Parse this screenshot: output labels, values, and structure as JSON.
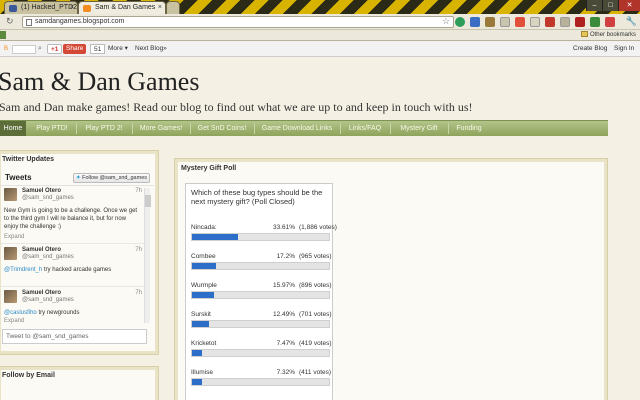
{
  "browser": {
    "tabs": [
      {
        "label": "(1) Hacked_PTD2"
      },
      {
        "label": "Sam & Dan Games"
      }
    ],
    "url": "samdangames.blogspot.com",
    "other_bookmarks": "Other bookmarks"
  },
  "navbar": {
    "share_label": "Share",
    "count": "51",
    "more": "More",
    "next_blog": "Next Blog»",
    "create_blog": "Create Blog",
    "sign_in": "Sign In"
  },
  "header": {
    "title": "Sam & Dan Games",
    "description": "Sam and Dan make games! Read our blog to find out what we are up to and keep in touch with us!"
  },
  "nav_tabs": [
    "Home",
    "Play PTD!",
    "Play PTD 2!",
    "More Games!",
    "Get SnD Coins!",
    "Game Download Links",
    "Links/FAQ",
    "Mystery Gift",
    "Funding"
  ],
  "twitter": {
    "title": "Twitter Updates",
    "header_label": "Tweets",
    "follow_label": "Follow @sam_snd_games",
    "tweets": [
      {
        "name": "Samuel Otero",
        "handle": "@sam_snd_games",
        "time": "7h",
        "text": "New Gym is going to be a challenge. Once we get to the third gym I will re balance it, but for now enjoy the challenge :)",
        "expand": "Expand"
      },
      {
        "name": "Samuel Otero",
        "handle": "@sam_snd_games",
        "time": "7h",
        "mention": "@Trimdrent_h",
        "text": " try hacked arcade games"
      },
      {
        "name": "Samuel Otero",
        "handle": "@sam_snd_games",
        "time": "7h",
        "mention": "@caslusfiho",
        "text": " try newgrounds",
        "expand": "Expand"
      }
    ],
    "input_placeholder": "Tweet to @sam_snd_games"
  },
  "follow_email": {
    "title": "Follow by Email"
  },
  "poll": {
    "title": "Mystery Gift Poll",
    "question": "Which of these bug types should be the next mystery gift? (Poll Closed)",
    "options": [
      {
        "name": "Nincada:",
        "pct_label": "33.61%",
        "votes_label": "(1,886 votes)",
        "pct": 33.61
      },
      {
        "name": "Combee",
        "pct_label": "17.2%",
        "votes_label": "(965 votes)",
        "pct": 17.2
      },
      {
        "name": "Wurmple",
        "pct_label": "15.97%",
        "votes_label": "(896 votes)",
        "pct": 15.97
      },
      {
        "name": "Surskit",
        "pct_label": "12.49%",
        "votes_label": "(701 votes)",
        "pct": 12.49
      },
      {
        "name": "Kricketot",
        "pct_label": "7.47%",
        "votes_label": "(419 votes)",
        "pct": 7.47
      },
      {
        "name": "Illumise",
        "pct_label": "7.32%",
        "votes_label": "(411 votes)",
        "pct": 7.32
      }
    ]
  },
  "colors": {
    "accent_green": "#8ea35b",
    "poll_bar": "#2d6fc8"
  }
}
